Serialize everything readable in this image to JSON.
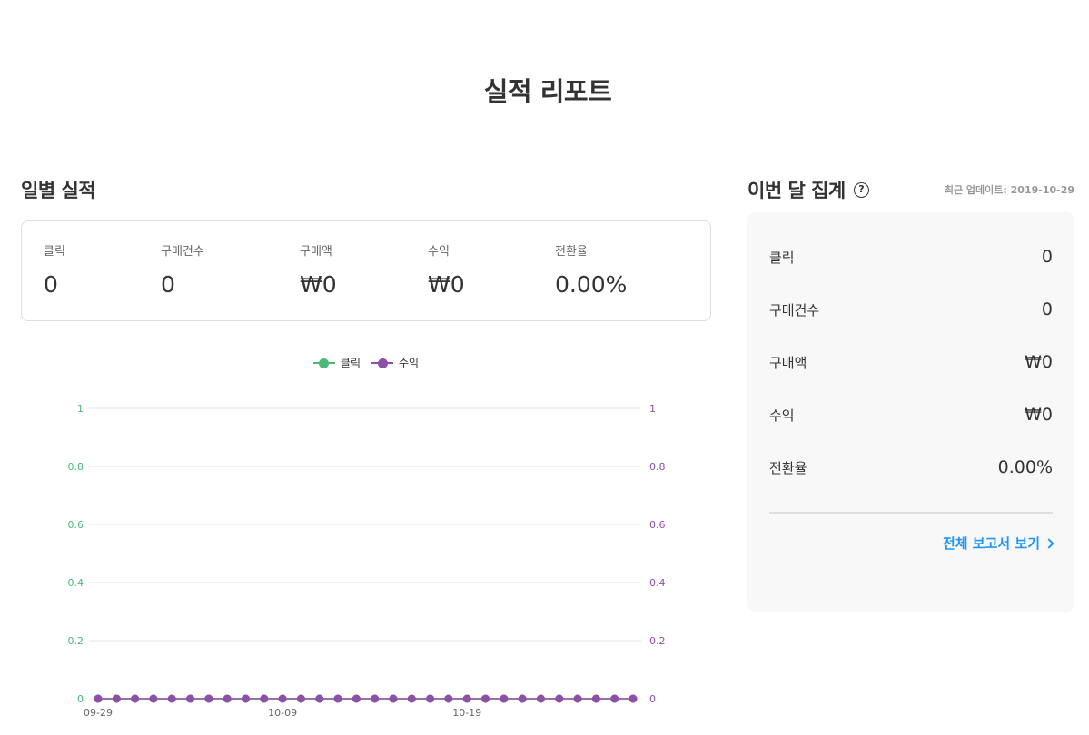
{
  "page_title": "실적 리포트",
  "daily": {
    "title": "일별 실적",
    "stats": [
      {
        "label": "클릭",
        "value": "0"
      },
      {
        "label": "구매건수",
        "value": "0"
      },
      {
        "label": "구매액",
        "value": "₩0"
      },
      {
        "label": "수익",
        "value": "₩0"
      },
      {
        "label": "전환율",
        "value": "0.00%"
      }
    ]
  },
  "monthly": {
    "title": "이번 달 집계",
    "help_icon": "?",
    "updated": "최근 업데이트: 2019-10-29",
    "rows": [
      {
        "label": "클릭",
        "value": "0"
      },
      {
        "label": "구매건수",
        "value": "0"
      },
      {
        "label": "구매액",
        "value": "₩0"
      },
      {
        "label": "수익",
        "value": "₩0"
      },
      {
        "label": "전환율",
        "value": "0.00%"
      }
    ],
    "full_report_label": "전체 보고서 보기"
  },
  "colors": {
    "click": "#4cb87a",
    "revenue": "#8e4fa8",
    "link": "#2196f3"
  },
  "chart_data": {
    "type": "line",
    "x": [
      "09-29",
      "09-30",
      "10-01",
      "10-02",
      "10-03",
      "10-04",
      "10-05",
      "10-06",
      "10-07",
      "10-08",
      "10-09",
      "10-10",
      "10-11",
      "10-12",
      "10-13",
      "10-14",
      "10-15",
      "10-16",
      "10-17",
      "10-18",
      "10-19",
      "10-20",
      "10-21",
      "10-22",
      "10-23",
      "10-24",
      "10-25",
      "10-26",
      "10-27",
      "10-28"
    ],
    "x_tick_labels": [
      "09-29",
      "10-09",
      "10-19"
    ],
    "series": [
      {
        "name": "클릭",
        "axis": "left",
        "values": [
          0,
          0,
          0,
          0,
          0,
          0,
          0,
          0,
          0,
          0,
          0,
          0,
          0,
          0,
          0,
          0,
          0,
          0,
          0,
          0,
          0,
          0,
          0,
          0,
          0,
          0,
          0,
          0,
          0,
          0
        ]
      },
      {
        "name": "수익",
        "axis": "right",
        "values": [
          0,
          0,
          0,
          0,
          0,
          0,
          0,
          0,
          0,
          0,
          0,
          0,
          0,
          0,
          0,
          0,
          0,
          0,
          0,
          0,
          0,
          0,
          0,
          0,
          0,
          0,
          0,
          0,
          0,
          0
        ]
      }
    ],
    "ylim": [
      0,
      1
    ],
    "y_ticks": [
      "0",
      "0.2",
      "0.4",
      "0.6",
      "0.8",
      "1"
    ],
    "grid": true,
    "legend": "top-center"
  }
}
